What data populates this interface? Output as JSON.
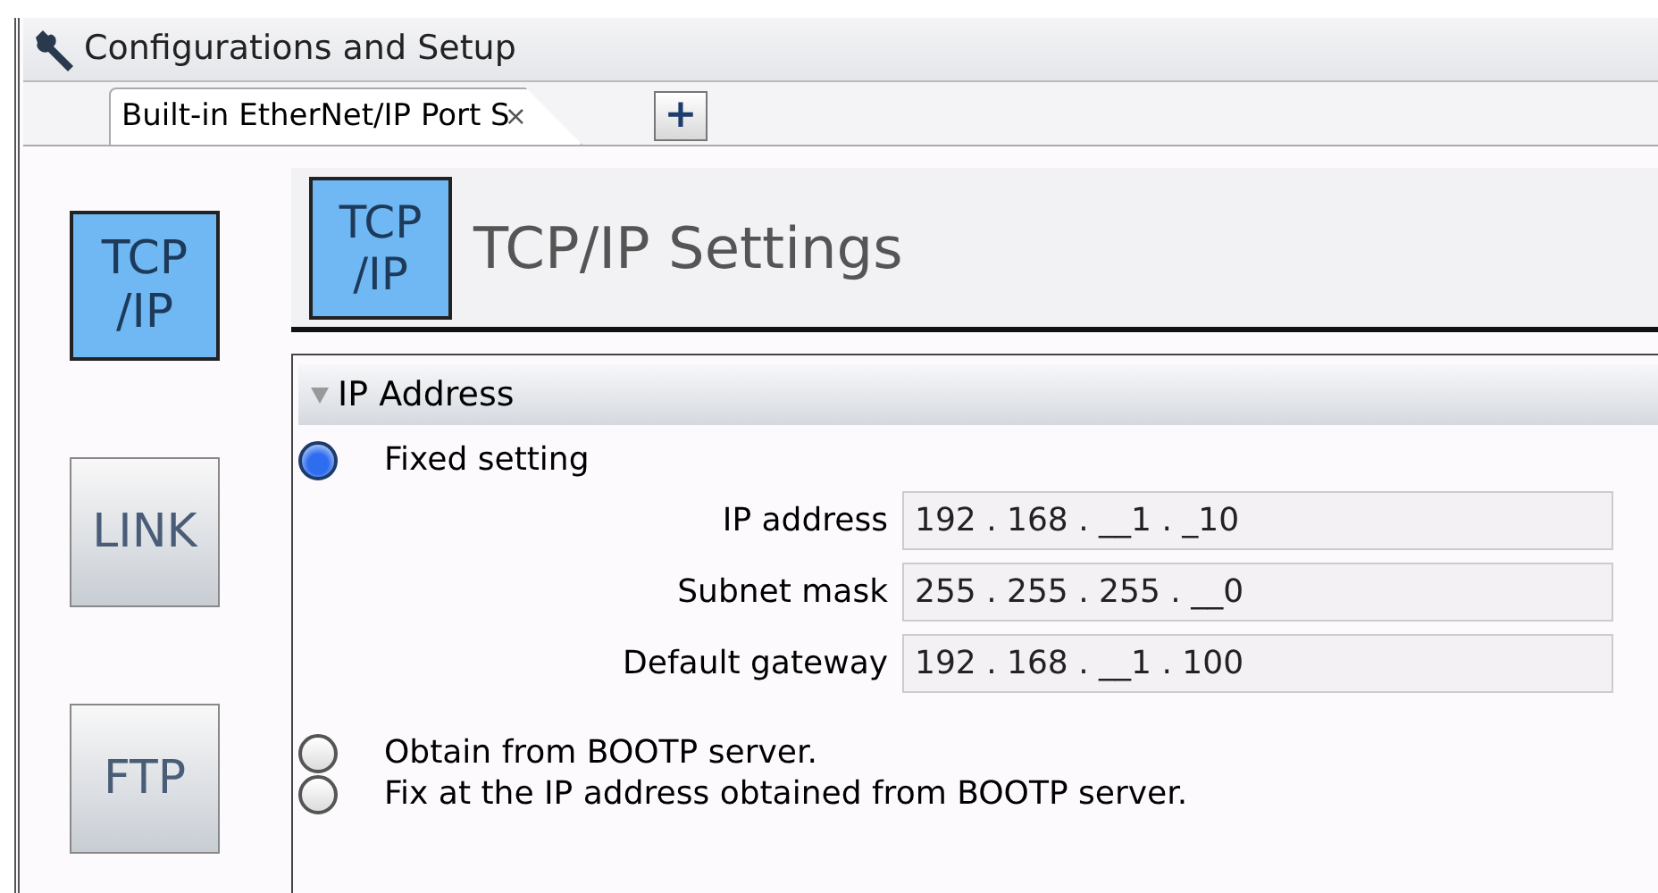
{
  "window": {
    "title": "Configurations and Setup"
  },
  "tabs": [
    {
      "label": "Built-in EtherNet/IP Port S",
      "close": "×",
      "selected": true
    }
  ],
  "add_tab": "+",
  "sidebar": {
    "items": [
      {
        "label": "TCP\n/IP",
        "selected": true
      },
      {
        "label": "LINK",
        "selected": false
      },
      {
        "label": "FTP",
        "selected": false
      }
    ]
  },
  "header": {
    "icon_label": "TCP\n/IP",
    "title": "TCP/IP Settings"
  },
  "section": {
    "title": "IP Address",
    "expanded": true,
    "options": [
      {
        "label": "Fixed setting",
        "selected": true,
        "fields": [
          {
            "label": "IP address",
            "value": "192 . 168 . __1 . _10"
          },
          {
            "label": "Subnet mask",
            "value": "255 . 255 . 255 . __0"
          },
          {
            "label": "Default gateway",
            "value": "192 . 168 . __1 . 100"
          }
        ]
      },
      {
        "label": "Obtain from BOOTP server.",
        "selected": false
      },
      {
        "label": "Fix at the IP address obtained from BOOTP server.",
        "selected": false
      }
    ]
  }
}
